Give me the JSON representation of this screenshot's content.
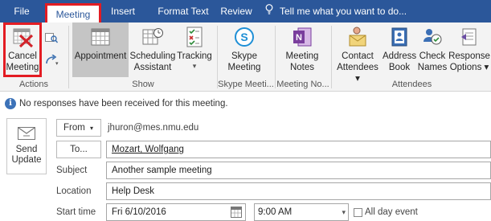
{
  "tabs": {
    "file": "File",
    "meeting": "Meeting",
    "insert": "Insert",
    "format_text": "Format Text",
    "review": "Review",
    "tell_me": "Tell me what you want to do..."
  },
  "ribbon": {
    "cancel_meeting": "Cancel Meeting",
    "cancel_line1": "Cancel",
    "cancel_line2": "Meeting",
    "actions_label": "Actions",
    "appointment": "Appointment",
    "scheduling_line1": "Scheduling",
    "scheduling_line2": "Assistant",
    "tracking": "Tracking",
    "show_label": "Show",
    "skype_line1": "Skype",
    "skype_line2": "Meeting",
    "skype_group_label": "Skype Meeti...",
    "notes_line1": "Meeting",
    "notes_line2": "Notes",
    "notes_group_label": "Meeting No...",
    "contact_line1": "Contact",
    "contact_line2": "Attendees",
    "address_line1": "Address",
    "address_line2": "Book",
    "check_line1": "Check",
    "check_line2": "Names",
    "response_line1": "Response",
    "response_line2": "Options",
    "attendees_label": "Attendees"
  },
  "info": {
    "message": "No responses have been received for this meeting."
  },
  "form": {
    "send_line1": "Send",
    "send_line2": "Update",
    "from_label": "From",
    "from_value": "jhuron@mes.nmu.edu",
    "to_label": "To...",
    "to_value": "Mozart, Wolfgang",
    "subject_label": "Subject",
    "subject_value": "Another sample meeting",
    "location_label": "Location",
    "location_value": "Help Desk",
    "start_label": "Start time",
    "start_date": "Fri 6/10/2016",
    "start_time": "9:00 AM",
    "all_day_label": "All day event"
  },
  "colors": {
    "tab_bar": "#2b579a",
    "highlight_box": "#e31c23",
    "ribbon_bg": "#f3f3f3"
  }
}
